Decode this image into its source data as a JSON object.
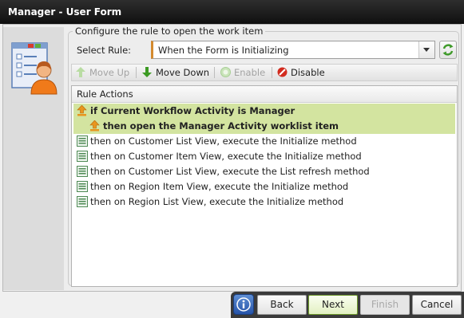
{
  "window": {
    "title": "Manager - User Form"
  },
  "group": {
    "legend": "Configure the rule to open the work item"
  },
  "select_rule": {
    "label": "Select Rule:",
    "value": "When the Form is Initializing"
  },
  "toolbar": {
    "move_up": "Move Up",
    "move_down": "Move Down",
    "enable": "Enable",
    "disable": "Disable"
  },
  "rules": {
    "header": "Rule Actions",
    "items": [
      {
        "text": "if Current Workflow Activity is Manager",
        "kind": "condition",
        "highlighted": true,
        "bold": true,
        "indent": 0
      },
      {
        "text": "then open the Manager Activity worklist item",
        "kind": "condition",
        "highlighted": true,
        "bold": true,
        "indent": 1
      },
      {
        "text": "then on Customer List View, execute the Initialize method",
        "kind": "action",
        "highlighted": false,
        "bold": false,
        "indent": 0
      },
      {
        "text": "then on Customer Item View, execute the Initialize method",
        "kind": "action",
        "highlighted": false,
        "bold": false,
        "indent": 0
      },
      {
        "text": "then on Customer List View, execute the List refresh method",
        "kind": "action",
        "highlighted": false,
        "bold": false,
        "indent": 0
      },
      {
        "text": "then on Region Item View, execute the Initialize method",
        "kind": "action",
        "highlighted": false,
        "bold": false,
        "indent": 0
      },
      {
        "text": "then on Region List View, execute the Initialize method",
        "kind": "action",
        "highlighted": false,
        "bold": false,
        "indent": 0
      }
    ]
  },
  "footer": {
    "info_icon": "info-icon",
    "back": "Back",
    "next": "Next",
    "finish": "Finish",
    "cancel": "Cancel"
  },
  "colors": {
    "highlight": "#d3e4a0",
    "accent": "#d48a2e",
    "title_bar": "#1a1a1a"
  }
}
